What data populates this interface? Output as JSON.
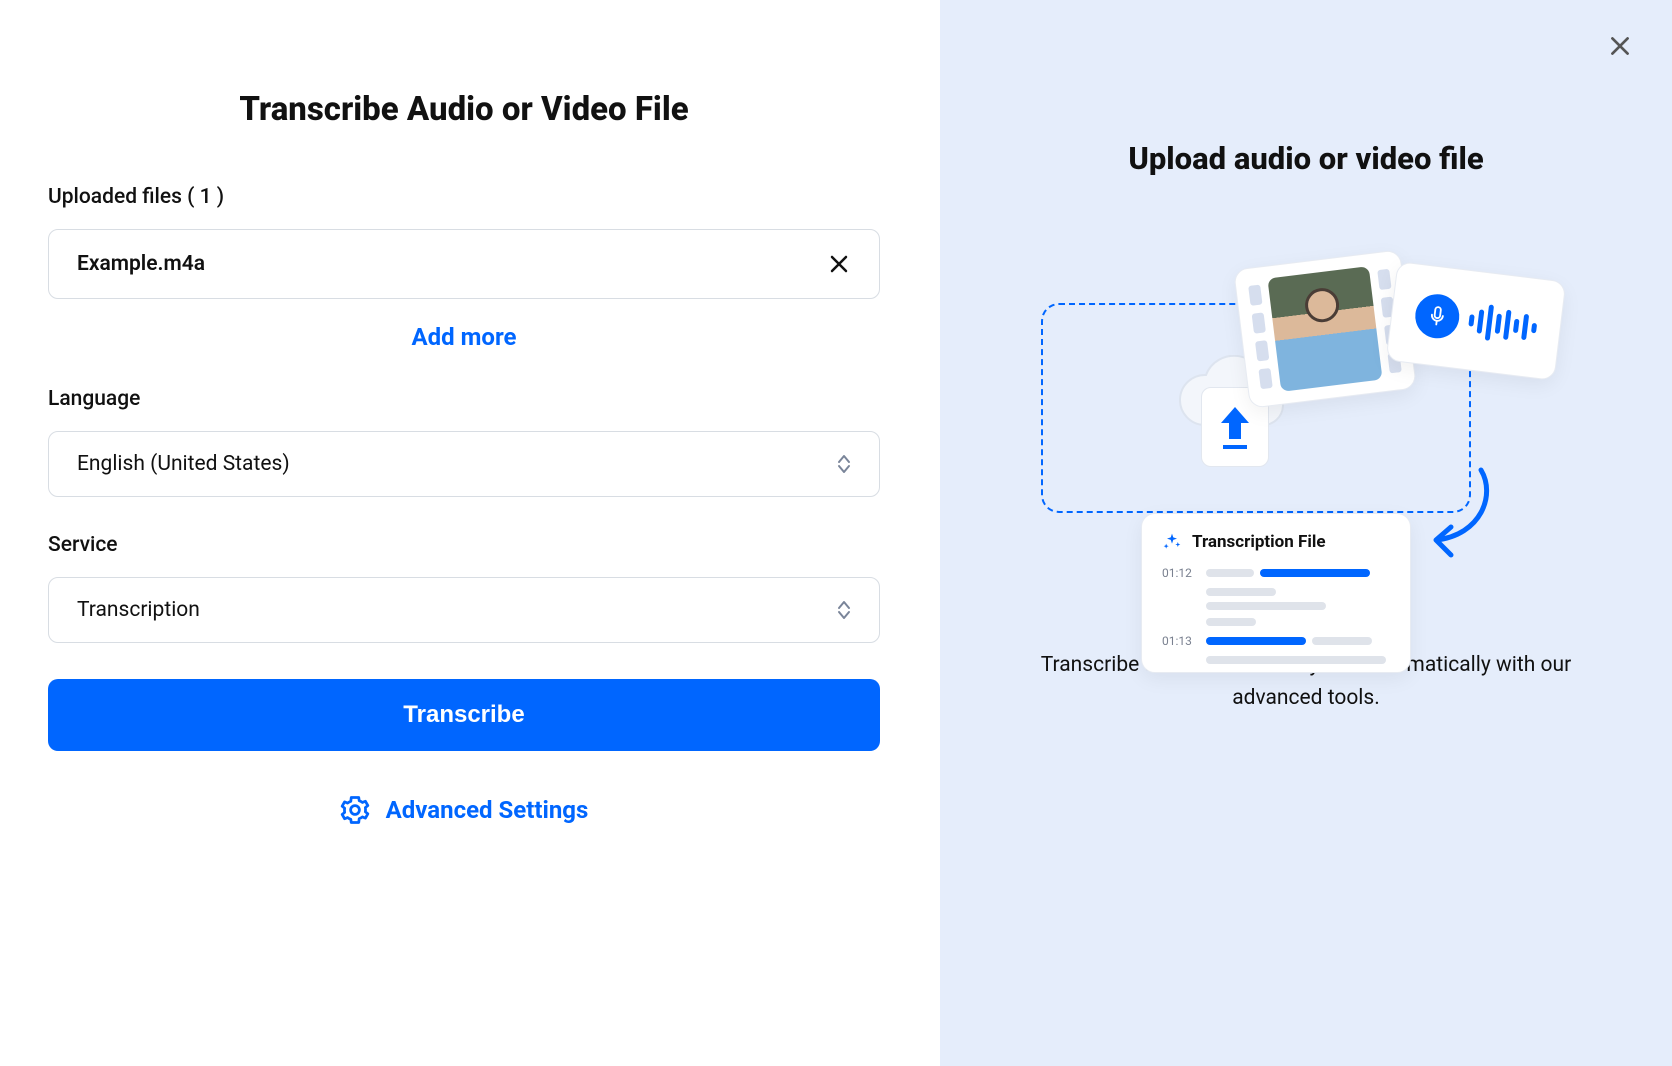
{
  "left": {
    "title": "Transcribe Audio or Video File",
    "uploaded_label": "Uploaded files ( 1 )",
    "files": [
      {
        "name": "Example.m4a"
      }
    ],
    "add_more": "Add more",
    "language_label": "Language",
    "language_value": "English (United States)",
    "service_label": "Service",
    "service_value": "Transcription",
    "transcribe_button": "Transcribe",
    "advanced_settings": "Advanced Settings"
  },
  "right": {
    "title": "Upload audio or video file",
    "transcription_file_label": "Transcription File",
    "timestamps": [
      "01:12",
      "01:13"
    ],
    "description": "Transcribe audio to text easily and automatically with our advanced tools."
  }
}
